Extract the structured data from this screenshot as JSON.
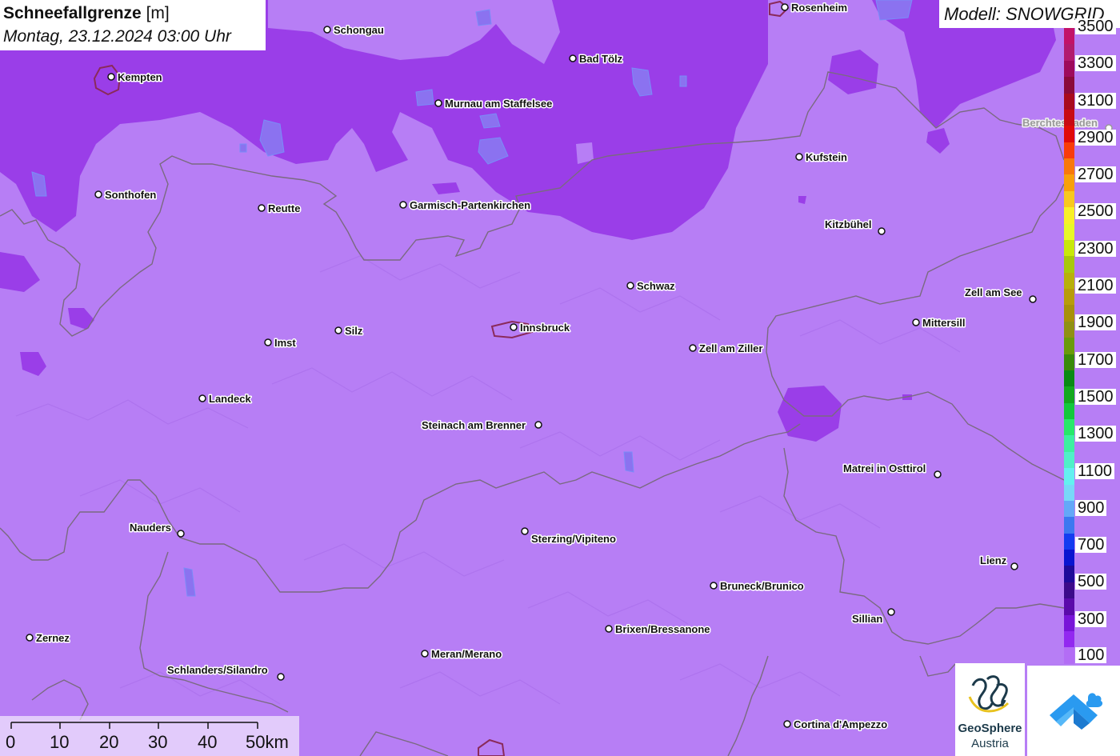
{
  "title": {
    "main": "Schneefallgrenze",
    "unit": "[m]",
    "date": "Montag, 23.12.2024 03:00 Uhr"
  },
  "model": {
    "label": "Modell: SNOWGRID"
  },
  "legend": {
    "labels": [
      "3500",
      "3300",
      "3100",
      "2900",
      "2700",
      "2500",
      "2300",
      "2100",
      "1900",
      "1700",
      "1500",
      "1300",
      "1100",
      "900",
      "700",
      "500",
      "300",
      "100"
    ],
    "colors": [
      "#c21268",
      "#b21a6e",
      "#9e0a5c",
      "#8a0a3a",
      "#a80a1e",
      "#c80a14",
      "#e00a0a",
      "#f83c0a",
      "#f8780a",
      "#f8a00a",
      "#f8c81e",
      "#f8f028",
      "#e8f828",
      "#c8e80a",
      "#a8c80a",
      "#b8b00a",
      "#b89c0a",
      "#a8900a",
      "#909014",
      "#6a9a0a",
      "#3a8a0a",
      "#0a8a14",
      "#14a81e",
      "#14c83c",
      "#28e86a",
      "#3cf0a0",
      "#50f0c8",
      "#64f0f0",
      "#78d8f8",
      "#64a8f8",
      "#3c78f0",
      "#143cf0",
      "#0a14d0",
      "#1e0a9a",
      "#3c0a8a",
      "#5a0aaa",
      "#7814d8",
      "#9228f0",
      "#b36df5"
    ]
  },
  "scale": {
    "labels": [
      "0",
      "10",
      "20",
      "30",
      "40",
      "50km"
    ]
  },
  "logos": {
    "geosphere_line1": "GeoSphere",
    "geosphere_line2": "Austria"
  },
  "cities": [
    {
      "name": "Schongau"
    },
    {
      "name": "Rosenheim"
    },
    {
      "name": "Kempten"
    },
    {
      "name": "Bad Tölz"
    },
    {
      "name": "Murnau am Staffelsee"
    },
    {
      "name": "Berchtesgaden"
    },
    {
      "name": "Kufstein"
    },
    {
      "name": "Sonthofen"
    },
    {
      "name": "Reutte"
    },
    {
      "name": "Garmisch-Partenkirchen"
    },
    {
      "name": "Kitzbühel"
    },
    {
      "name": "Schwaz"
    },
    {
      "name": "Zell am See"
    },
    {
      "name": "Mittersill"
    },
    {
      "name": "Silz"
    },
    {
      "name": "Imst"
    },
    {
      "name": "Innsbruck"
    },
    {
      "name": "Zell am Ziller"
    },
    {
      "name": "Landeck"
    },
    {
      "name": "Steinach am Brenner"
    },
    {
      "name": "Matrei in Osttirol"
    },
    {
      "name": "Nauders"
    },
    {
      "name": "Sterzing/Vipiteno"
    },
    {
      "name": "Lienz"
    },
    {
      "name": "Bruneck/Brunico"
    },
    {
      "name": "Sillian"
    },
    {
      "name": "Brixen/Bressanone"
    },
    {
      "name": "Zernez"
    },
    {
      "name": "Meran/Merano"
    },
    {
      "name": "Schlanders/Silandro"
    },
    {
      "name": "Cortina d'Ampezzo"
    }
  ]
}
